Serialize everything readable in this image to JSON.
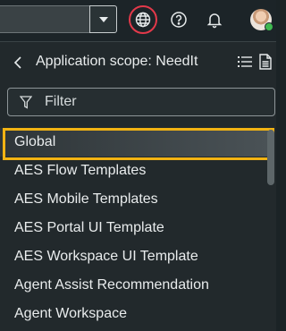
{
  "header": {
    "dropdown_icon": "caret-down-icon",
    "globe_icon": "globe-icon",
    "help_icon": "help-circle-icon",
    "bell_icon": "bell-icon",
    "avatar_status_color": "#3fb950",
    "globe_ring_color": "#e3394a"
  },
  "panel": {
    "title": "Application scope: NeedIt",
    "back_icon": "chevron-left-icon",
    "list_icon": "list-icon",
    "doc_icon": "document-icon",
    "filter_placeholder": "Filter",
    "filter_icon": "filter-icon",
    "highlight_color": "#f2b313",
    "items": [
      {
        "label": "Global"
      },
      {
        "label": "AES Flow Templates"
      },
      {
        "label": "AES Mobile Templates"
      },
      {
        "label": "AES Portal UI Template"
      },
      {
        "label": "AES Workspace UI Template"
      },
      {
        "label": "Agent Assist Recommendation"
      },
      {
        "label": "Agent Workspace"
      }
    ]
  }
}
